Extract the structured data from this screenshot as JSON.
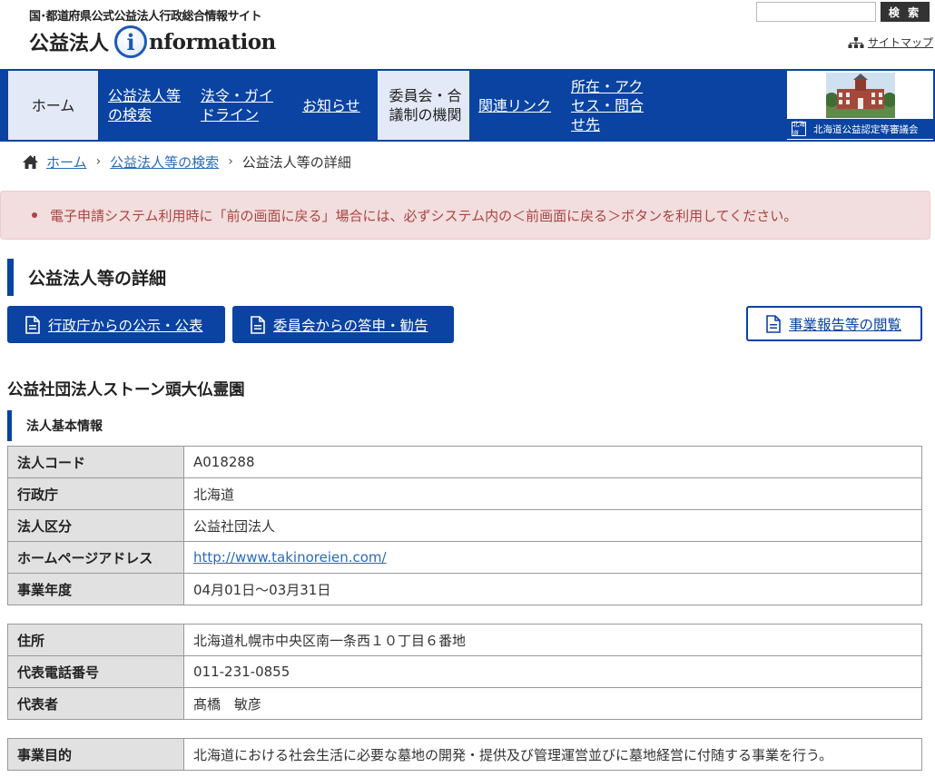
{
  "header": {
    "site_tag": "国･都道府県公式公益法人行政総合情報サイト",
    "logo_pre": "公益法人",
    "logo_i": "i",
    "logo_post": "nformation",
    "search_placeholder": "",
    "search_button": "検 索",
    "sitemap": "サイトマップ"
  },
  "nav": {
    "home": "ホーム",
    "search": [
      "公益法人等",
      "の検索"
    ],
    "laws": [
      "法令・ガイ",
      "ドライン"
    ],
    "news": "お知らせ",
    "committee": [
      "委員会・合",
      "議制の機関"
    ],
    "links": "関連リンク",
    "access": [
      "所在・アク",
      "セス・問合",
      "せ先"
    ],
    "banner_label": "北海道公益認定等審議会",
    "banner_badge": "北海道"
  },
  "breadcrumb": {
    "home": "ホーム",
    "search": "公益法人等の検索",
    "current": "公益法人等の詳細"
  },
  "alert": {
    "message": "電子申請システム利用時に「前の画面に戻る」場合には、必ずシステム内の＜前画面に戻る＞ボタンを利用してください。"
  },
  "page_title": "公益法人等の詳細",
  "buttons": {
    "gov_notice": "行政庁からの公示・公表",
    "committee_report": "委員会からの答申・勧告",
    "business_report": "事業報告等の閲覧"
  },
  "corp_name": "公益社団法人ストーン頭大仏霊園",
  "section_title": "法人基本情報",
  "basic_info": [
    {
      "label": "法人コード",
      "value": "A018288"
    },
    {
      "label": "行政庁",
      "value": "北海道"
    },
    {
      "label": "法人区分",
      "value": "公益社団法人"
    },
    {
      "label": "ホームページアドレス",
      "value": "http://www.takinoreien.com/"
    },
    {
      "label": "事業年度",
      "value": "04月01日～03月31日"
    }
  ],
  "contact_info": [
    {
      "label": "住所",
      "value": "北海道札幌市中央区南一条西１０丁目６番地"
    },
    {
      "label": "代表電話番号",
      "value": "011-231-0855"
    },
    {
      "label": "代表者",
      "value": "髙橋　敏彦"
    }
  ],
  "purpose": {
    "label": "事業目的",
    "value": "北海道における社会生活に必要な墓地の開発・提供及び管理運営並びに墓地経営に付随する事業を行う。"
  }
}
